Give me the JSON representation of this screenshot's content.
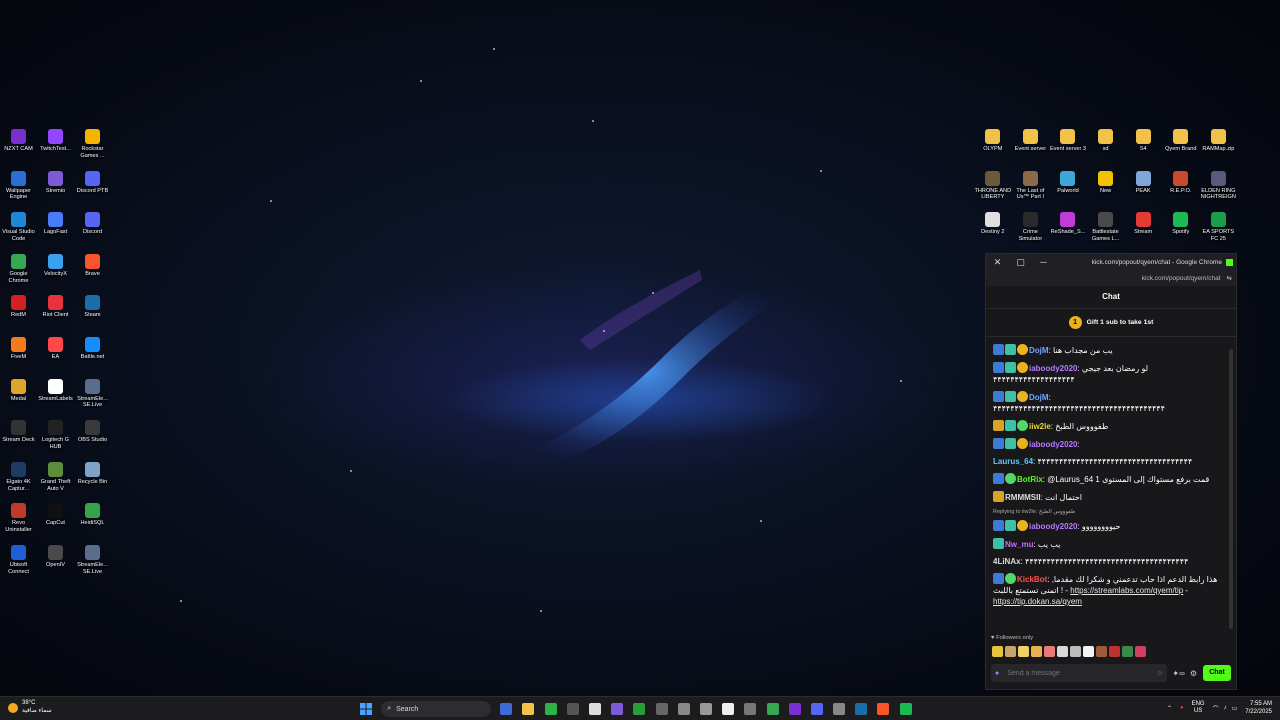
{
  "desktop_left_icons": [
    {
      "label": "NZXT CAM",
      "icon": "nzxt-cam-icon",
      "color": "#7a2fd0"
    },
    {
      "label": "TwitchTest...",
      "icon": "twitchtest-icon",
      "color": "#9146ff"
    },
    {
      "label": "Rockstar Games ...",
      "icon": "rockstar-icon",
      "color": "#f4b400"
    },
    {
      "label": "Wallpaper Engine",
      "icon": "wallpaper-engine-icon",
      "color": "#2a6fd6"
    },
    {
      "label": "Stremio",
      "icon": "stremio-icon",
      "color": "#7b5bd6"
    },
    {
      "label": "Discord PTB",
      "icon": "discord-icon",
      "color": "#5865f2"
    },
    {
      "label": "Visual Studio Code",
      "icon": "vscode-icon",
      "color": "#1e88d6"
    },
    {
      "label": "LagoFast",
      "icon": "lagofast-icon",
      "color": "#4a7bf7"
    },
    {
      "label": "Discord",
      "icon": "discord-icon",
      "color": "#5865f2"
    },
    {
      "label": "Google Chrome",
      "icon": "chrome-icon",
      "color": "#34a853"
    },
    {
      "label": "VelocityX",
      "icon": "velocityx-icon",
      "color": "#3aa0f0"
    },
    {
      "label": "Brave",
      "icon": "brave-icon",
      "color": "#fb542b"
    },
    {
      "label": "RedM",
      "icon": "redm-icon",
      "color": "#d32020"
    },
    {
      "label": "Riot Client",
      "icon": "riot-icon",
      "color": "#e8323c"
    },
    {
      "label": "Steam",
      "icon": "steam-icon",
      "color": "#1b6fa8"
    },
    {
      "label": "FiveM",
      "icon": "fivem-icon",
      "color": "#f27b1d"
    },
    {
      "label": "EA",
      "icon": "ea-icon",
      "color": "#ff4747"
    },
    {
      "label": "Battle.net",
      "icon": "battlenet-icon",
      "color": "#148eff"
    },
    {
      "label": "Medal",
      "icon": "medal-icon",
      "color": "#e0a32b"
    },
    {
      "label": "StreamLabels",
      "icon": "streamlabels-icon",
      "color": "#ffffff"
    },
    {
      "label": "StreamEle... SE.Live",
      "icon": "streamelements-icon",
      "color": "#5a6d8c"
    },
    {
      "label": "Stream Deck",
      "icon": "stream-deck-icon",
      "color": "#333333"
    },
    {
      "label": "Logitech G HUB",
      "icon": "logitech-icon",
      "color": "#222222"
    },
    {
      "label": "OBS Studio",
      "icon": "obs-icon",
      "color": "#3a3a3a"
    },
    {
      "label": "Elgato 4K Captur...",
      "icon": "elgato-icon",
      "color": "#1f3b63"
    },
    {
      "label": "Grand Theft Auto V",
      "icon": "gta-icon",
      "color": "#5b8d3a"
    },
    {
      "label": "Recycle Bin",
      "icon": "recycle-bin-icon",
      "color": "#7fa3c8"
    },
    {
      "label": "Revo Uninstaller",
      "icon": "revo-icon",
      "color": "#c0392b"
    },
    {
      "label": "CapCut",
      "icon": "capcut-icon",
      "color": "#111111"
    },
    {
      "label": "HeidiSQL",
      "icon": "heidisql-icon",
      "color": "#37a34a"
    },
    {
      "label": "Ubisoft Connect",
      "icon": "ubisoft-icon",
      "color": "#1f5fd6"
    },
    {
      "label": "OpenIV",
      "icon": "openiv-icon",
      "color": "#4a4a4a"
    },
    {
      "label": "StreamEle... SE.Live",
      "icon": "streamelements-icon",
      "color": "#5a6d8c"
    }
  ],
  "desktop_right_icons": [
    {
      "label": "OLYPM",
      "icon": "folder-icon",
      "color": "#f0c24a"
    },
    {
      "label": "Event server",
      "icon": "folder-icon",
      "color": "#f0c24a"
    },
    {
      "label": "Event server 3",
      "icon": "folder-icon",
      "color": "#f0c24a"
    },
    {
      "label": "sd",
      "icon": "folder-icon",
      "color": "#f0c24a"
    },
    {
      "label": "S4",
      "icon": "folder-icon",
      "color": "#f0c24a"
    },
    {
      "label": "Qyem Brand",
      "icon": "folder-icon",
      "color": "#f0c24a"
    },
    {
      "label": "RAMMap.zip",
      "icon": "zip-folder-icon",
      "color": "#f0c24a"
    },
    {
      "label": "THRONE AND LIBERTY",
      "icon": "throne-liberty-icon",
      "color": "#6b5a3a"
    },
    {
      "label": "The Last of Us™ Part I",
      "icon": "last-of-us-icon",
      "color": "#8a6a4a"
    },
    {
      "label": "Palworld",
      "icon": "palworld-icon",
      "color": "#3fa6d8"
    },
    {
      "label": "New",
      "icon": "warning-icon",
      "color": "#f2c200"
    },
    {
      "label": "PEAK",
      "icon": "peak-icon",
      "color": "#7fa8d8"
    },
    {
      "label": "R.E.P.O.",
      "icon": "repo-icon",
      "color": "#c74b2a"
    },
    {
      "label": "ELDEN RING NIGHTREIGN",
      "icon": "elden-ring-icon",
      "color": "#5a5a7a"
    },
    {
      "label": "Destiny 2",
      "icon": "destiny-icon",
      "color": "#e0e0e0"
    },
    {
      "label": "Crime Simulator",
      "icon": "crime-sim-icon",
      "color": "#2a2a2a"
    },
    {
      "label": "ReShade_S...",
      "icon": "reshade-icon",
      "color": "#c23bd6"
    },
    {
      "label": "Battlestate Games L...",
      "icon": "battlestate-icon",
      "color": "#4a4a4a"
    },
    {
      "label": "Stream",
      "icon": "x-icon",
      "color": "#e53935"
    },
    {
      "label": "Spotify",
      "icon": "spotify-icon",
      "color": "#1db954"
    },
    {
      "label": "EA SPORTS FC 25",
      "icon": "ea-fc-icon",
      "color": "#1a9e4a"
    }
  ],
  "chat_window": {
    "title": "kick.com/popout/qyem/chat - Google Chrome",
    "url": "kick.com/popout/qyem/chat",
    "header": "Chat",
    "gift_text": "Gift 1 sub to take 1st",
    "gift_count": "1",
    "followers_only": "Followers only",
    "input_placeholder": "Send a message",
    "chat_button": "Chat",
    "messages": [
      {
        "badges": [
          "blue",
          "teal",
          "gold"
        ],
        "user": "DojM",
        "color": "#6fa8ff",
        "text": "يب من مجداب هنا"
      },
      {
        "badges": [
          "blue",
          "teal",
          "gold"
        ],
        "user": "iaboody2020",
        "color": "#b57cff",
        "text": "لو رمضان بعد جيجي ۴۴۴۴۴۴۴۴۴۴۴۴۴۴۴۴۴۴۴"
      },
      {
        "badges": [
          "blue",
          "teal",
          "gold"
        ],
        "user": "DojM",
        "color": "#6fa8ff",
        "text": "۴۴۴۴۴۴۴۴۴۴۴۴۴۴۴۴۴۴۴۴۴۴۴۴۴۴۴۴۴۴۴۴۴۴۴۴۴۴۴۴"
      },
      {
        "badges": [
          "crown",
          "teal",
          "green"
        ],
        "user": "iiw2le",
        "color": "#e7d33c",
        "text": "طفوووس الطبخ"
      },
      {
        "badges": [
          "blue",
          "teal",
          "gold"
        ],
        "user": "iaboody2020",
        "color": "#b57cff",
        "text": ""
      },
      {
        "badges": [],
        "user": "Laurus_64",
        "color": "#5ec8ff",
        "text": "۴۴۴۴۴۴۴۴۴۴۴۴۴۴۴۴۴۴۴۴۴۴۴۴۴۴۴۴۴۴۴۴۴۴۴۴"
      },
      {
        "badges": [
          "blue",
          "green"
        ],
        "user": "BotRix",
        "color": "#53fc18",
        "text": "@Laurus_64 قمت برفع مستواك إلى المستوى 1"
      },
      {
        "badges": [
          "crown"
        ],
        "user": "RMMMSII",
        "color": "#dddddd",
        "text": "احتمال انت"
      },
      {
        "badges": [
          "blue",
          "teal",
          "gold"
        ],
        "user": "iaboody2020",
        "color": "#b57cff",
        "text": "حيوووووووو",
        "reply": "Replying to iiw2le: طفوووس الطبخ"
      },
      {
        "badges": [
          "teal"
        ],
        "user": "Nw_mu",
        "color": "#c76bff",
        "text": "يب يب"
      },
      {
        "badges": [],
        "user": "4LiNAx",
        "color": "#dddddd",
        "text": "۴۴۴۴۴۴۴۴۴۴۴۴۴۴۴۴۴۴۴۴۴۴۴۴۴۴۴۴۴۴۴۴۴۴۴۴۴۴"
      },
      {
        "badges": [
          "blue",
          "green"
        ],
        "user": "KickBot",
        "color": "#ff5050",
        "text": "هذا رابط الدعم اذا حاب تدعمني و شكرا لك مقدما, اتمنى تستمتع باللبث ! - ",
        "link1": "https://streamlabs.com/qyem/tip",
        "sep": " - ",
        "link2": "https://tip.dokan.sa/qyem"
      }
    ]
  },
  "taskbar": {
    "temperature": "38°C",
    "weather_text": "سماء صافية",
    "search_label": "Search",
    "lang_top": "ENG",
    "lang_bottom": "US",
    "time": "7:55 AM",
    "date": "7/22/2025",
    "apps": [
      {
        "icon": "widgets-icon",
        "color": "#3f6bd6"
      },
      {
        "icon": "file-explorer-icon",
        "color": "#f2c24a"
      },
      {
        "icon": "app-icon",
        "color": "#2fb24a"
      },
      {
        "icon": "terminal-icon",
        "color": "#555555"
      },
      {
        "icon": "calendar-icon",
        "color": "#dddddd"
      },
      {
        "icon": "controller-icon",
        "color": "#7b5bd6"
      },
      {
        "icon": "xbox-icon",
        "color": "#2a9d3a"
      },
      {
        "icon": "steam-icon",
        "color": "#666666"
      },
      {
        "icon": "app-icon",
        "color": "#888888"
      },
      {
        "icon": "settings-icon",
        "color": "#999999"
      },
      {
        "icon": "capcut-icon",
        "color": "#eeeeee"
      },
      {
        "icon": "app-icon",
        "color": "#777777"
      },
      {
        "icon": "chrome-icon",
        "color": "#34a853"
      },
      {
        "icon": "nzxt-icon",
        "color": "#7a2fd0"
      },
      {
        "icon": "discord-icon",
        "color": "#5865f2"
      },
      {
        "icon": "app-icon",
        "color": "#888888"
      },
      {
        "icon": "steam-icon",
        "color": "#1b6fa8"
      },
      {
        "icon": "brave-icon",
        "color": "#fb542b"
      },
      {
        "icon": "spotify-icon",
        "color": "#1db954"
      }
    ]
  }
}
